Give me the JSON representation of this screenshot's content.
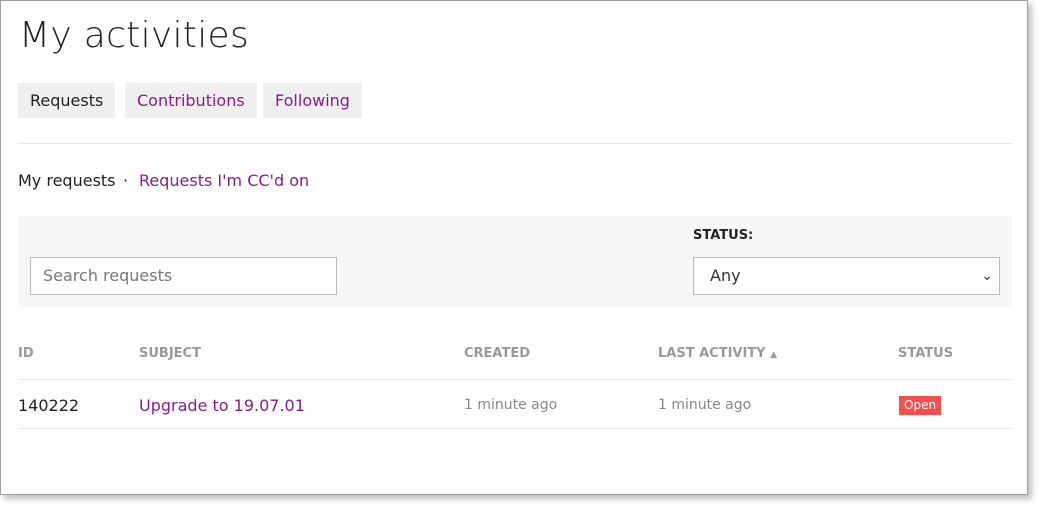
{
  "page": {
    "title": "My activities"
  },
  "tabs": [
    {
      "label": "Requests",
      "active": true
    },
    {
      "label": "Contributions"
    },
    {
      "label": "Following"
    }
  ],
  "subnav": {
    "active": "My requests",
    "separator": "·",
    "other": "Requests I'm CC'd on"
  },
  "filters": {
    "search_placeholder": "Search requests",
    "status_label": "STATUS:",
    "status_value": "Any"
  },
  "table": {
    "headers": {
      "id": "ID",
      "subject": "SUBJECT",
      "created": "CREATED",
      "last_activity": "LAST ACTIVITY",
      "status": "STATUS"
    },
    "sort_icon": "▲",
    "rows": [
      {
        "id": "140222",
        "subject": "Upgrade to 19.07.01",
        "created": "1 minute ago",
        "last_activity": "1 minute ago",
        "status": "Open"
      }
    ]
  },
  "colors": {
    "link": "#8b1c8c",
    "badge_open": "#f25050"
  }
}
